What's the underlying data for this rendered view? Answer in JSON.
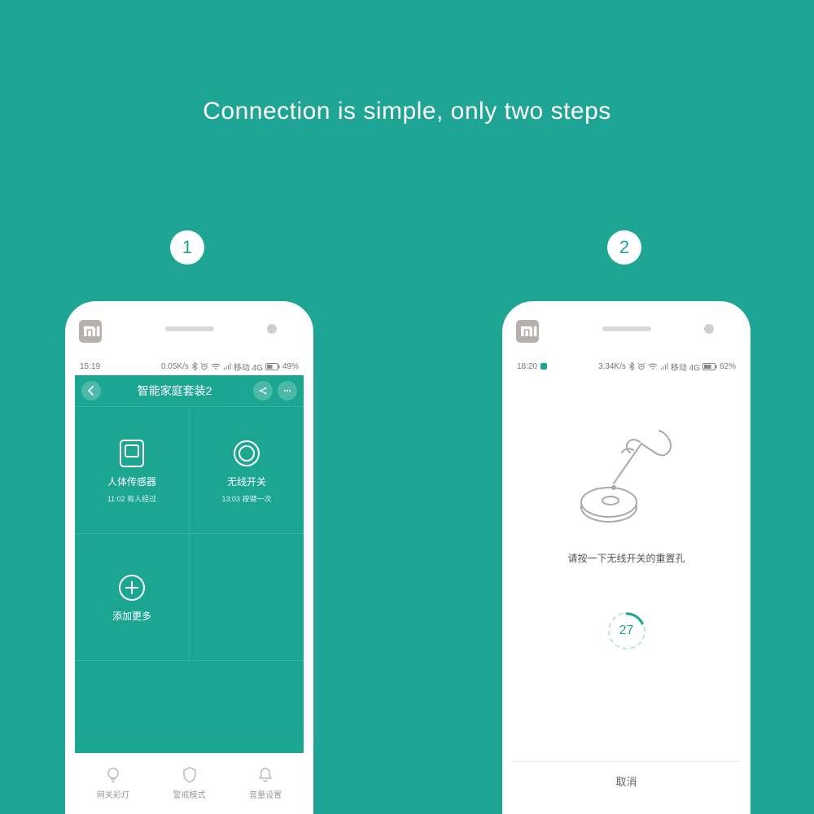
{
  "headline": "Connection is simple, only two steps",
  "steps": {
    "one": "1",
    "two": "2"
  },
  "brand": "mi",
  "phone1": {
    "status": {
      "time": "15:19",
      "net_speed": "0.05K/s",
      "net_label": "移动 4G",
      "battery": "49%"
    },
    "titlebar": {
      "title": "智能家庭套装2"
    },
    "tiles": [
      {
        "label": "人体传感器",
        "sub": "11:02 有人经过",
        "icon": "sensor"
      },
      {
        "label": "无线开关",
        "sub": "13:03 按键一次",
        "icon": "circle"
      },
      {
        "label": "添加更多",
        "sub": "",
        "icon": "plus"
      }
    ],
    "bottom": [
      {
        "label": "网关彩灯",
        "icon": "bulb"
      },
      {
        "label": "警戒模式",
        "icon": "shield"
      },
      {
        "label": "音量设置",
        "icon": "bell"
      }
    ]
  },
  "phone2": {
    "status": {
      "time": "18:20",
      "net_speed": "3.34K/s",
      "net_label": "移动 4G",
      "battery": "62%"
    },
    "instruction": "请按一下无线开关的重置孔",
    "countdown": "27",
    "cancel": "取消"
  }
}
